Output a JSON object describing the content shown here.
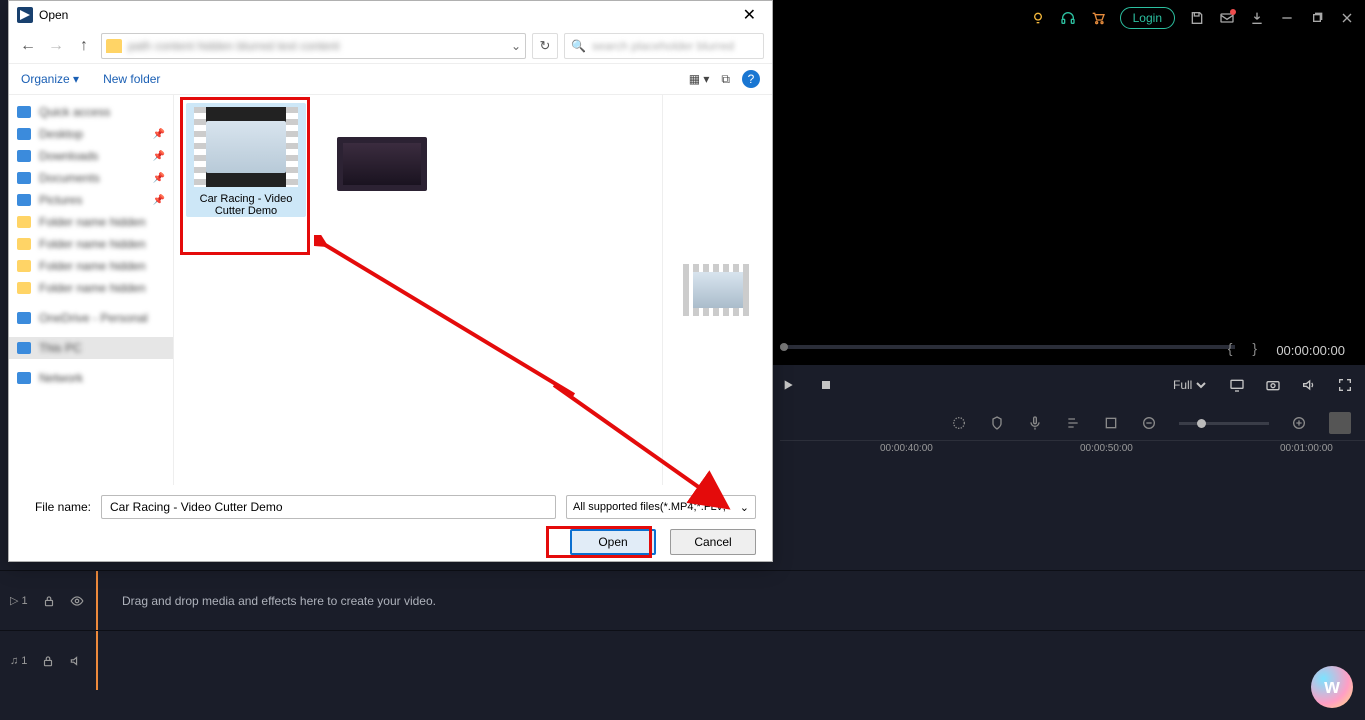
{
  "app": {
    "login": "Login"
  },
  "preview": {
    "brackets": "{ }",
    "timecode": "00:00:00:00",
    "zoom": "Full"
  },
  "ruler": {
    "marks": [
      "00:00:40:00",
      "00:00:50:00",
      "00:01:00:00"
    ]
  },
  "tracks": {
    "video": {
      "label": "▷ 1",
      "hint": "Drag and drop media and effects here to create your video."
    },
    "audio": {
      "label": "♫ 1"
    }
  },
  "dialog": {
    "title": "Open",
    "search_placeholder": "Search",
    "organize": "Organize",
    "newfolder": "New folder",
    "sidebar": {
      "quick": "Quick access",
      "items": [
        {
          "name": "Desktop",
          "pin": true
        },
        {
          "name": "Downloads",
          "pin": true
        },
        {
          "name": "Documents",
          "pin": true
        },
        {
          "name": "Pictures",
          "pin": true
        }
      ],
      "folders": [
        "",
        "",
        "",
        ""
      ],
      "onedrive": "OneDrive - Personal",
      "thispc": "This PC",
      "network": "Network"
    },
    "files": {
      "selected": "Car Racing - Video Cutter Demo",
      "second": ""
    },
    "footer": {
      "label": "File name:",
      "filename": "Car Racing - Video Cutter Demo",
      "filetype": "All supported files(*.MP4;*.FLV;",
      "open": "Open",
      "cancel": "Cancel"
    }
  }
}
